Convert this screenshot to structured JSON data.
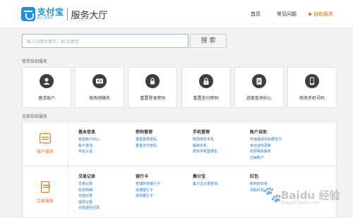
{
  "header": {
    "logo_cn": "支付宝",
    "logo_en": "ALIPAY",
    "title": "服务大厅",
    "nav": [
      "首页",
      "常见问题",
      "自助服务"
    ]
  },
  "search": {
    "placeholder": "输入问题关键字，如:余额宝",
    "button": "搜 索"
  },
  "common": {
    "title": "常用自助服务",
    "items": [
      "激活账户",
      "修改邮箱名",
      "重置登录密码",
      "重置支付密码",
      "进度查询中心",
      "修改手机号码"
    ]
  },
  "all": {
    "title": "全部自助服务",
    "rows": [
      {
        "side": "账户服务",
        "columns": [
          {
            "title": "基本信息",
            "links": [
              "查看账户中心",
              "账户激活",
              "实名认证"
            ]
          },
          {
            "title": "密码管理",
            "links": [
              "重置登录密码",
              "重置支付密码"
            ]
          },
          {
            "title": "手机管理",
            "links": [
              "修改绑定手机",
              "解绑手机",
              "修改手机登录名"
            ]
          },
          {
            "title": "账户自助",
            "links": [
              "开通或关闭余额支付",
              "身份证件更新",
              "花呗相关服务",
              "注销账户"
            ]
          }
        ]
      },
      {
        "side": "交易服务",
        "columns": [
          {
            "title": "交易记录",
            "links": [
              "交易记录",
              "收支明细",
              "充值记录",
              "提现记录",
              "充值退回记录"
            ]
          },
          {
            "title": "银行卡",
            "links": [
              "管理所有银行卡",
              "快捷银行卡",
              "添加银行卡"
            ]
          },
          {
            "title": "集分宝",
            "links": [
              "集分宝记录查询"
            ]
          },
          {
            "title": "红包",
            "links": [
              "收到的红包",
              "领取红包"
            ]
          }
        ]
      }
    ]
  },
  "watermark": {
    "text": "Baidu 经验",
    "url": "jingyan.baidu.com"
  },
  "colors": {
    "brand_blue": "#1a8fe3",
    "accent_orange": "#f06a0e",
    "link_blue": "#1a73c9"
  }
}
